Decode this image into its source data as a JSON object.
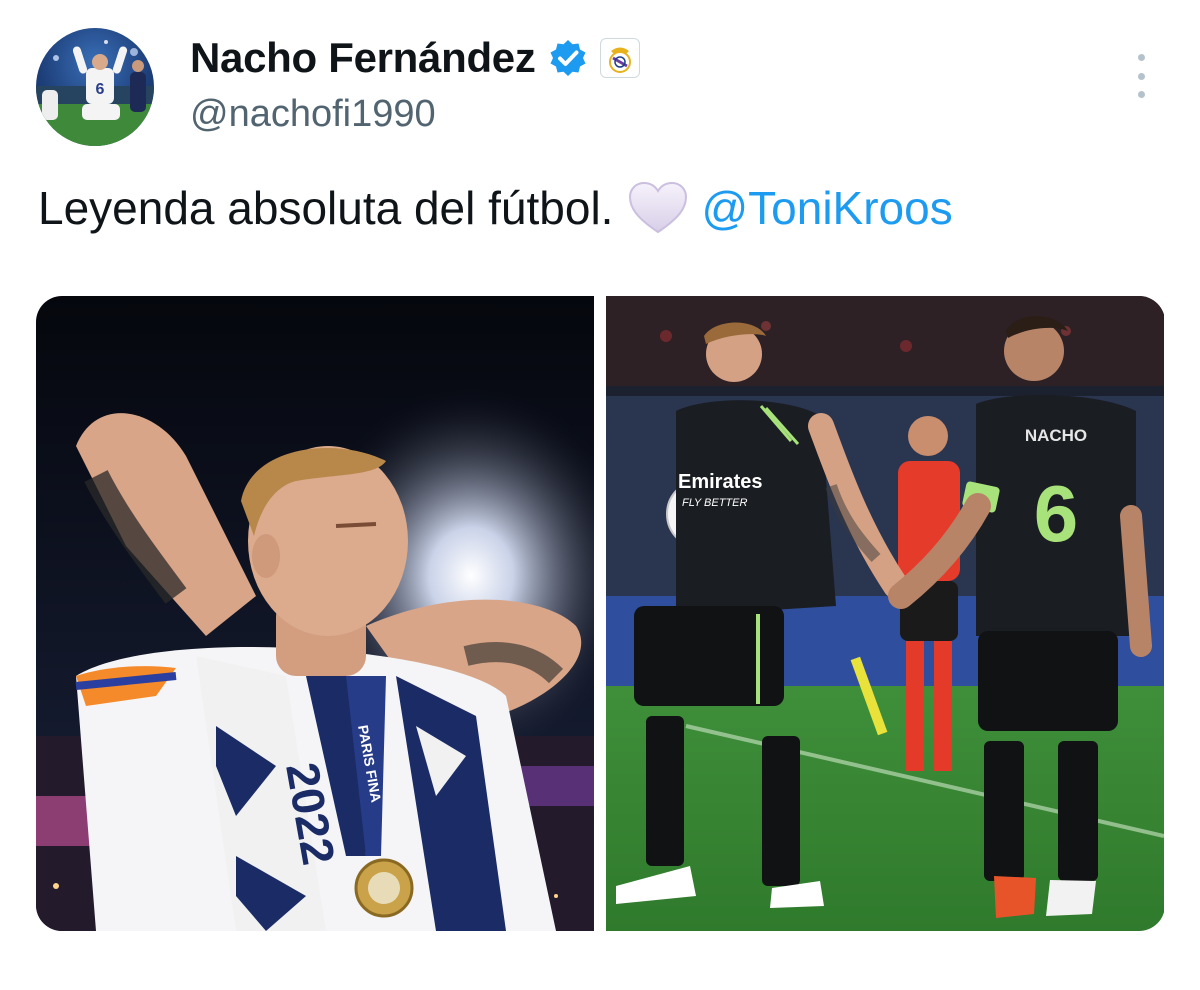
{
  "author": {
    "display_name": "Nacho Fernández",
    "handle": "@nachofi1990",
    "verified_badge_icon": "verified-check-icon",
    "affiliate_icon": "real-madrid-crest-icon",
    "avatar_jersey_number": "6"
  },
  "tweet": {
    "text": "Leyenda absoluta del fútbol.",
    "emoji_icon": "white-heart-icon",
    "mention": "@ToniKroos"
  },
  "photos": [
    {
      "scarf_text": "2022",
      "ribbon_text": "PARIS FINA"
    },
    {
      "sponsor_text": "Emirates",
      "sponsor_subtext": "FLY BETTER",
      "player_name": "NACHO",
      "jersey_number": "6"
    }
  ],
  "colors": {
    "accent": "#1d9bf0",
    "secondary_text": "#536471",
    "jersey_accent": "#a8e27a"
  }
}
